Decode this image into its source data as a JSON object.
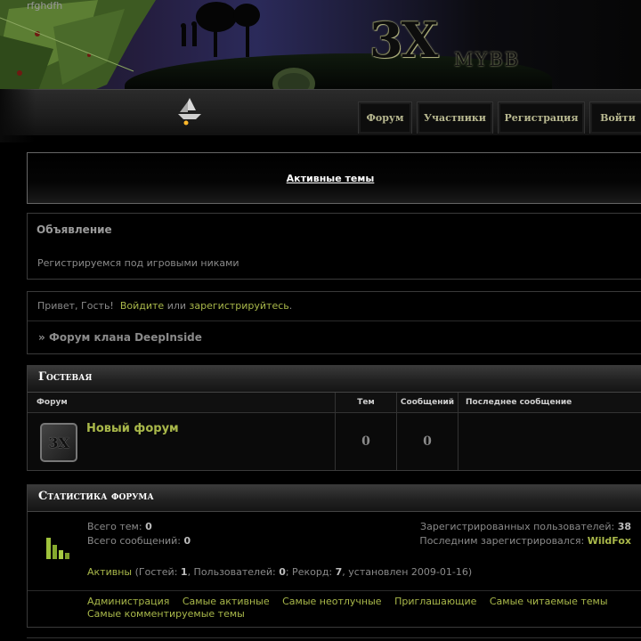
{
  "site": {
    "name": "rfghdfh"
  },
  "logo": {
    "main": "3X",
    "sub": "MYBB"
  },
  "nav": [
    {
      "label": "Форум"
    },
    {
      "label": "Участники"
    },
    {
      "label": "Регистрация"
    },
    {
      "label": "Войти"
    }
  ],
  "active_topics": {
    "label": "Активные темы"
  },
  "announcement": {
    "title": "Объявление",
    "text": "Регистрируемся под игровыми никами"
  },
  "greeting": {
    "prefix": "Привет, Гость!",
    "login_link": "Войдите",
    "or": "или",
    "register_link": "зарегистрируйтесь",
    "suffix": "."
  },
  "breadcrumb": {
    "marker": "»",
    "text": "Форум клана DeepInside"
  },
  "category": {
    "title": "Гостевая",
    "columns": {
      "forum": "Форум",
      "topics": "Тем",
      "posts": "Сообщений",
      "last": "Последнее сообщение"
    },
    "forums": [
      {
        "name": "Новый форум",
        "topics": "0",
        "posts": "0",
        "last": ""
      }
    ]
  },
  "stats": {
    "title": "Статистика форума",
    "total_topics_label": "Всего тем:",
    "total_topics": "0",
    "total_posts_label": "Всего сообщений:",
    "total_posts": "0",
    "registered_label": "Зарегистрированных пользователей:",
    "registered": "38",
    "last_registered_label": "Последним зарегистрировался:",
    "last_registered": "WildFox",
    "online": {
      "label": "Активны",
      "open": "(Гостей:",
      "guests": "1",
      "users_label": ", Пользователей:",
      "users": "0",
      "record_label": "; Рекорд:",
      "record": "7",
      "record_date": ", установлен 2009-01-16)"
    },
    "links": [
      "Администрация",
      "Самые активные",
      "Самые неотлучные",
      "Приглашающие",
      "Самые читаемые темы",
      "Самые комментируемые темы"
    ]
  },
  "colors": {
    "accent": "#a9b84a",
    "background": "#000000",
    "text": "#8a8a8a"
  }
}
